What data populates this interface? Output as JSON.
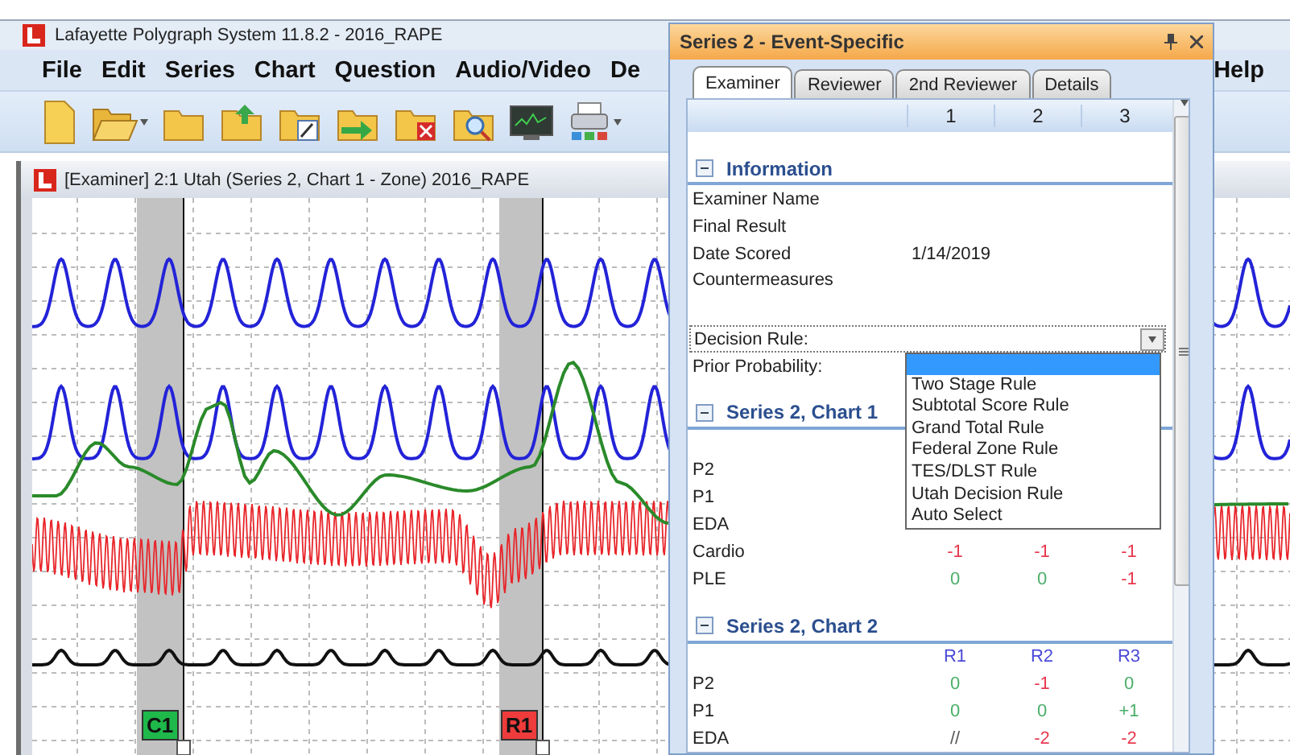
{
  "window": {
    "title": "Lafayette Polygraph System 11.8.2 - 2016_RAPE"
  },
  "menu": [
    "File",
    "Edit",
    "Series",
    "Chart",
    "Question",
    "Audio/Video",
    "De"
  ],
  "menu_right": [
    "Help"
  ],
  "toolbar": [
    {
      "kind": "new",
      "dropdown": false
    },
    {
      "kind": "open",
      "dropdown": true
    },
    {
      "kind": "folder",
      "dropdown": false
    },
    {
      "kind": "upload",
      "dropdown": false
    },
    {
      "kind": "edit",
      "dropdown": false
    },
    {
      "kind": "transfer",
      "dropdown": false
    },
    {
      "kind": "delete",
      "dropdown": false
    },
    {
      "kind": "search",
      "dropdown": false
    },
    {
      "kind": "monitor",
      "dropdown": false
    },
    {
      "kind": "printer",
      "dropdown": true
    }
  ],
  "chart_window": {
    "title": "[Examiner] 2:1  Utah (Series 2, Chart 1 - Zone) 2016_RAPE",
    "markers": [
      {
        "label": "C1",
        "color": "#1fb84a"
      },
      {
        "label": "R1",
        "color": "#ee3b3b"
      }
    ]
  },
  "panel": {
    "title": "Series 2 - Event-Specific",
    "tabs": [
      {
        "label": "Examiner",
        "selected": true
      },
      {
        "label": "Reviewer",
        "selected": false
      },
      {
        "label": "2nd Reviewer",
        "selected": false
      },
      {
        "label": "Details",
        "selected": false
      }
    ],
    "columns": [
      "1",
      "2",
      "3"
    ],
    "information": {
      "title": "Information",
      "expanded": true,
      "fields": [
        {
          "label": "Examiner Name"
        },
        {
          "label": "Final Result"
        },
        {
          "label": "Date Scored",
          "value": "1/14/2019"
        },
        {
          "label": "Countermeasures"
        }
      ]
    },
    "decision_rule": {
      "label": "Decision Rule:",
      "expanded": true,
      "options": [
        {
          "label": "Two Stage Rule",
          "selected": false
        },
        {
          "label": "Subtotal Score Rule",
          "selected": false
        },
        {
          "label": "Grand Total Rule",
          "selected": false
        },
        {
          "label": "Federal Zone Rule",
          "selected": false
        },
        {
          "label": "TES/DLST Rule",
          "selected": false
        },
        {
          "label": "Utah Decision Rule",
          "selected": false
        },
        {
          "label": "Auto Select",
          "selected": false
        }
      ]
    },
    "prior_probability": {
      "label": "Prior Probability:"
    },
    "sections": [
      {
        "title": "Series 2, Chart 1",
        "expanded": true,
        "rows": [
          {
            "label": "P2",
            "cells": []
          },
          {
            "label": "P1",
            "cells": []
          },
          {
            "label": "EDA",
            "cells": []
          },
          {
            "label": "Cardio",
            "cells": [
              {
                "text": "-1",
                "color": "#e8384f"
              },
              {
                "text": "-1",
                "color": "#e8384f"
              },
              {
                "text": "-1",
                "color": "#e8384f"
              }
            ]
          },
          {
            "label": "PLE",
            "cells": [
              {
                "text": "0",
                "color": "#4caf6a"
              },
              {
                "text": "0",
                "color": "#4caf6a"
              },
              {
                "text": "-1",
                "color": "#e8384f"
              }
            ]
          }
        ]
      },
      {
        "title": "Series 2, Chart 2",
        "expanded": true,
        "columns": [
          "R1",
          "R2",
          "R3"
        ],
        "rows": [
          {
            "label": "P2",
            "cells": [
              {
                "text": "0",
                "color": "#4caf6a"
              },
              {
                "text": "-1",
                "color": "#e8384f"
              },
              {
                "text": "0",
                "color": "#4caf6a"
              }
            ]
          },
          {
            "label": "P1",
            "cells": [
              {
                "text": "0",
                "color": "#4caf6a"
              },
              {
                "text": "0",
                "color": "#4caf6a"
              },
              {
                "text": "+1",
                "color": "#4caf6a"
              }
            ]
          },
          {
            "label": "EDA",
            "cells": [
              {
                "text": "//",
                "color": "#555555"
              },
              {
                "text": "-2",
                "color": "#e8384f"
              },
              {
                "text": "-2",
                "color": "#e8384f"
              }
            ]
          }
        ]
      }
    ]
  }
}
